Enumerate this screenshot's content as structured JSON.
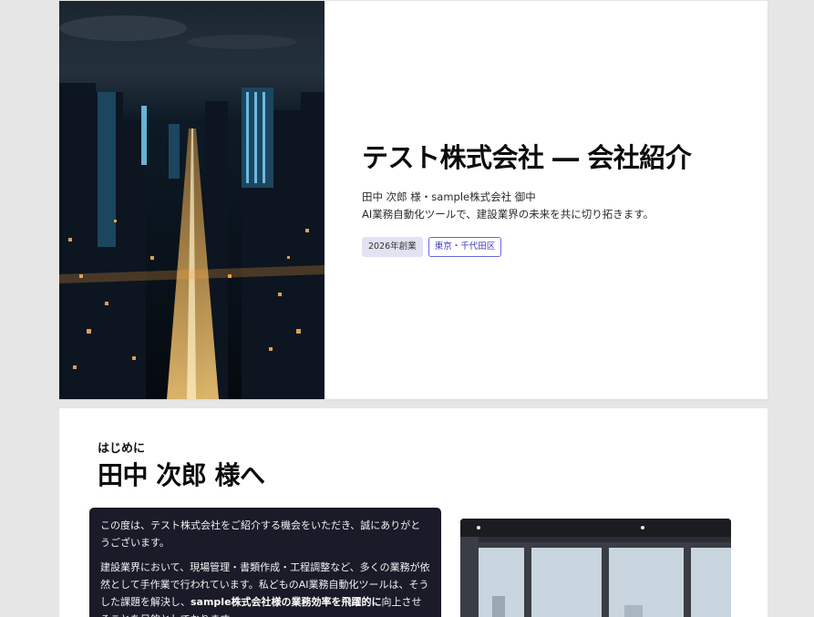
{
  "hero": {
    "title": "テスト株式会社 ― 会社紹介",
    "recipient_line": "田中 次郎 様・sample株式会社 御中",
    "tagline": "AI業務自動化ツールで、建設業界の未来を共に切り拓きます。",
    "tags": [
      "2026年創業",
      "東京・千代田区"
    ],
    "image": "night-city-skyline"
  },
  "intro": {
    "eyebrow": "はじめに",
    "heading": "田中 次郎 様へ",
    "para1": "この度は、テスト株式会社をご紹介する機会をいただき、誠にありがとうございます。",
    "para2_a": "建設業界において、現場管理・書類作成・工程調整など、多くの業務が依然として手作業で行われています。私どものAI業務自動化ツールは、そうした課題を解決し、",
    "para2_b": "sample株式会社様の業務効率を飛躍的に",
    "para2_c": "向上させることを目的としております。",
    "image": "office-window-photo"
  },
  "colors": {
    "accent": "#3b38c8",
    "dark_panel": "#1a1a28",
    "page_bg": "#e6e6e6"
  }
}
